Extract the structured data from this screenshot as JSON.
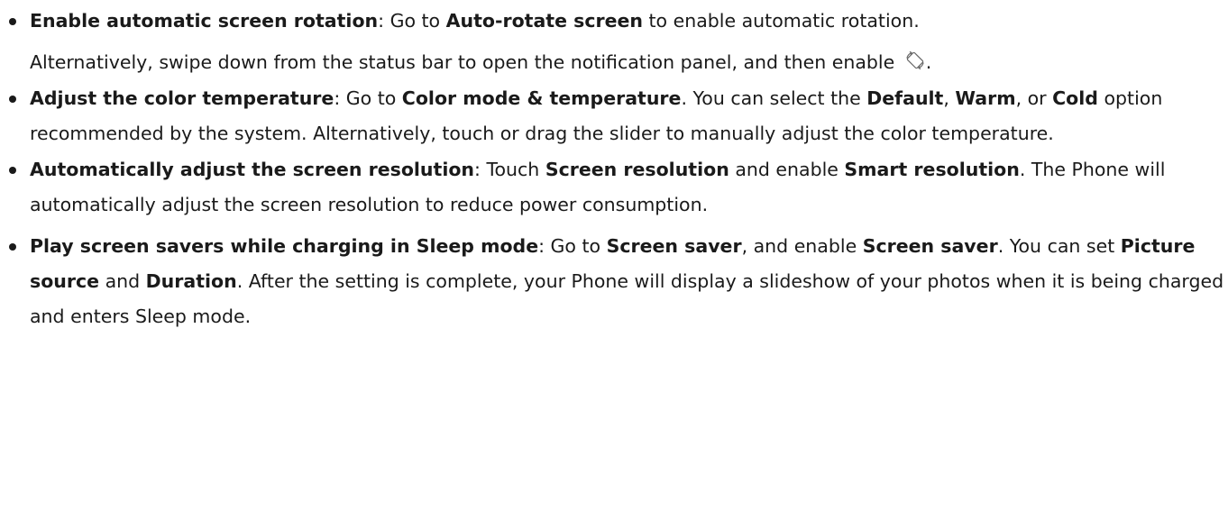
{
  "icons": {
    "rotate": "auto-rotate-icon"
  },
  "items": [
    {
      "title": "Enable automatic screen rotation",
      "p1": [
        ": Go to ",
        "Auto-rotate screen",
        " to enable automatic rotation."
      ],
      "p2": [
        "Alternatively, swipe down from the status bar to open the notification panel, and then enable ",
        "."
      ]
    },
    {
      "title": "Adjust the color temperature",
      "p1": [
        ": Go to ",
        "Color mode & temperature",
        ". You can select the ",
        "Default",
        ", ",
        "Warm",
        ", or ",
        "Cold",
        " option recommended by the system. Alternatively, touch or drag the slider to manually adjust the color temperature."
      ]
    },
    {
      "title": "Automatically adjust the screen resolution",
      "p1": [
        ": Touch ",
        "Screen resolution",
        " and enable ",
        "Smart resolution",
        ". The Phone will automatically adjust the screen resolution to reduce power consumption."
      ]
    },
    {
      "title": "Play screen savers while charging in Sleep mode",
      "p1": [
        ": Go to ",
        "Screen saver",
        ", and enable ",
        "Screen saver",
        ". You can set ",
        "Picture source",
        " and ",
        "Duration",
        ". After the setting is complete, your Phone will display a slideshow of your photos when it is being charged and enters Sleep mode."
      ]
    }
  ]
}
